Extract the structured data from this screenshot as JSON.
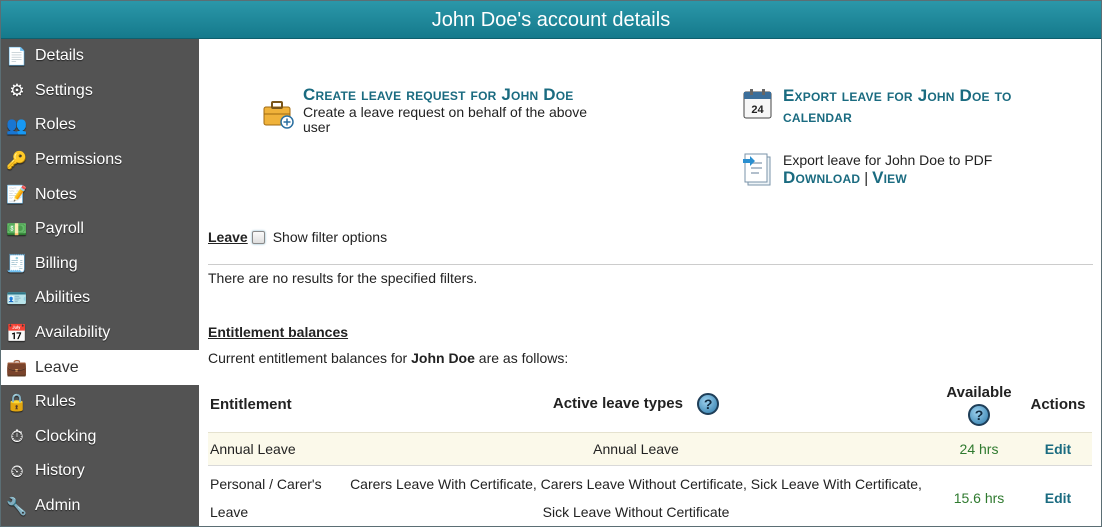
{
  "title": "John Doe's account details",
  "sidebar": {
    "items": [
      {
        "label": "Details",
        "icon": "details-icon",
        "glyph": "📄"
      },
      {
        "label": "Settings",
        "icon": "gear-icon",
        "glyph": "⚙"
      },
      {
        "label": "Roles",
        "icon": "roles-icon",
        "glyph": "👥"
      },
      {
        "label": "Permissions",
        "icon": "permissions-icon",
        "glyph": "🔑"
      },
      {
        "label": "Notes",
        "icon": "notes-icon",
        "glyph": "📝"
      },
      {
        "label": "Payroll",
        "icon": "payroll-icon",
        "glyph": "💵"
      },
      {
        "label": "Billing",
        "icon": "billing-icon",
        "glyph": "🧾"
      },
      {
        "label": "Abilities",
        "icon": "abilities-icon",
        "glyph": "🪪"
      },
      {
        "label": "Availability",
        "icon": "calendar-icon",
        "glyph": "📅"
      },
      {
        "label": "Leave",
        "icon": "briefcase-icon",
        "glyph": "💼"
      },
      {
        "label": "Rules",
        "icon": "lock-icon",
        "glyph": "🔒"
      },
      {
        "label": "Clocking",
        "icon": "clock-icon",
        "glyph": "⏱"
      },
      {
        "label": "History",
        "icon": "history-icon",
        "glyph": "⏲"
      },
      {
        "label": "Admin",
        "icon": "wrench-icon",
        "glyph": "🔧"
      }
    ],
    "active": "Leave"
  },
  "actions": {
    "create_link": "Create leave request for John Doe",
    "create_desc": "Create a leave request on behalf of the above user",
    "export_calendar_link": "Export leave for John Doe to calendar",
    "calendar_day": "24",
    "export_pdf_text": "Export leave for John Doe to PDF",
    "download_link": "Download",
    "separator": "|",
    "view_link": "View"
  },
  "filters": {
    "leave_label": "Leave",
    "show_filter_label": "Show filter options",
    "no_results": "There are no results for the specified filters."
  },
  "entitlements": {
    "title": "Entitlement balances",
    "desc_prefix": "Current entitlement balances for",
    "desc_name": "John Doe",
    "desc_suffix": "are as follows:",
    "headers": {
      "entitlement": "Entitlement",
      "active_types": "Active leave types",
      "available": "Available",
      "actions": "Actions"
    },
    "help_glyph": "?",
    "rows": [
      {
        "entitlement": "Annual Leave",
        "types": "Annual Leave",
        "available": "24 hrs",
        "action": "Edit"
      },
      {
        "entitlement": "Personal / Carer's Leave",
        "types": "Carers Leave With Certificate, Carers Leave Without Certificate, Sick Leave With Certificate, Sick Leave Without Certificate",
        "available": "15.6 hrs",
        "action": "Edit"
      }
    ]
  }
}
